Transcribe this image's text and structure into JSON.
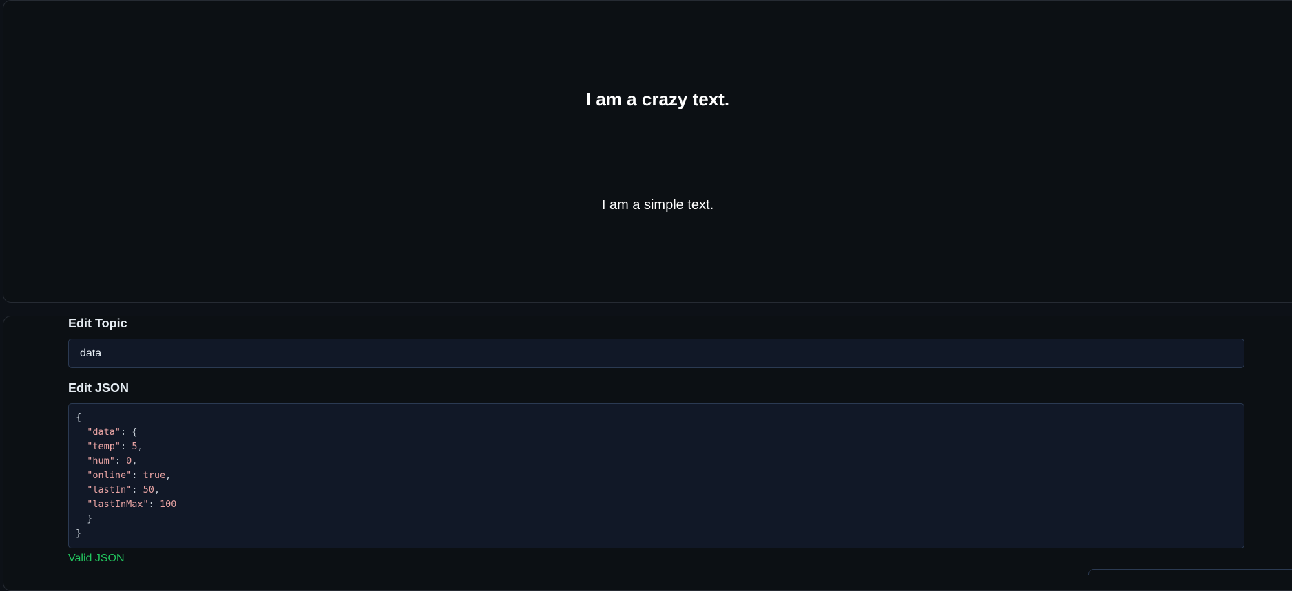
{
  "preview": {
    "crazy_text": "I am a crazy text.",
    "simple_text": "I am a simple text."
  },
  "editor": {
    "topic_label": "Edit Topic",
    "topic_value": "data",
    "json_label": "Edit JSON",
    "json_lines": [
      {
        "indent": "",
        "key": "",
        "sep": "",
        "val": "",
        "tail": "{"
      },
      {
        "indent": "  ",
        "key": "\"data\"",
        "sep": ": ",
        "val": "",
        "tail": "{"
      },
      {
        "indent": "  ",
        "key": "\"temp\"",
        "sep": ": ",
        "val": "5",
        "tail": ","
      },
      {
        "indent": "  ",
        "key": "\"hum\"",
        "sep": ": ",
        "val": "0",
        "tail": ","
      },
      {
        "indent": "  ",
        "key": "\"online\"",
        "sep": ": ",
        "val": "true",
        "tail": ","
      },
      {
        "indent": "  ",
        "key": "\"lastIn\"",
        "sep": ": ",
        "val": "50",
        "tail": ","
      },
      {
        "indent": "  ",
        "key": "\"lastInMax\"",
        "sep": ": ",
        "val": "100",
        "tail": ""
      },
      {
        "indent": "  ",
        "key": "",
        "sep": "",
        "val": "",
        "tail": "}"
      },
      {
        "indent": "",
        "key": "",
        "sep": "",
        "val": "",
        "tail": "}"
      }
    ],
    "status_text": "Valid JSON",
    "status_color": "#22c55e"
  }
}
